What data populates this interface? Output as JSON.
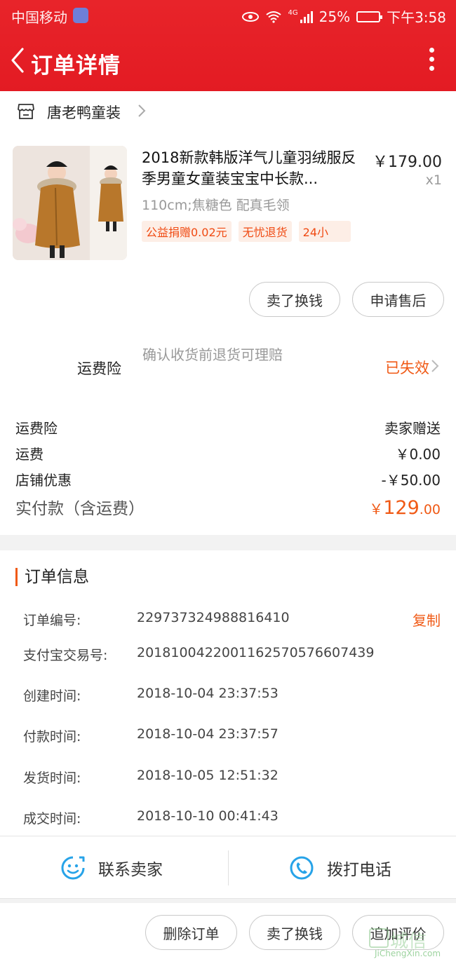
{
  "status_bar": {
    "carrier": "中国移动",
    "network": "4G",
    "battery": "25%",
    "time": "下午3:58"
  },
  "nav": {
    "title": "订单详情"
  },
  "shop": {
    "name": "唐老鸭童装"
  },
  "product": {
    "title": "2018新款韩版洋气儿童羽绒服反季男童女童装宝宝中长款...",
    "price": "￥179.00",
    "quantity": "x1",
    "spec": "110cm;焦糖色  配真毛领",
    "tags": [
      "公益捐赠0.02元",
      "无忧退货",
      "24小"
    ]
  },
  "product_actions": {
    "sell_exchange": "卖了换钱",
    "after_sale": "申请售后"
  },
  "freight_insurance": {
    "label": "运费险",
    "description": "确认收货前退货可理赔",
    "status": "已失效"
  },
  "summary": {
    "rows": [
      {
        "label": "运费险",
        "value": "卖家赠送"
      },
      {
        "label": "运费",
        "value": "￥0.00"
      },
      {
        "label": "店铺优惠",
        "value": "-￥50.00"
      }
    ],
    "total_label": "实付款（含运费）",
    "total_currency": "￥",
    "total_int": "129",
    "total_dec": ".00"
  },
  "order_info": {
    "title": "订单信息",
    "copy_label": "复制",
    "rows": [
      {
        "label": "订单编号:",
        "value": "229737324988816410"
      },
      {
        "label": "支付宝交易号:",
        "value": "2018100422001162570576607439"
      },
      {
        "label": "创建时间:",
        "value": "2018-10-04 23:37:53"
      },
      {
        "label": "付款时间:",
        "value": "2018-10-04 23:37:57"
      },
      {
        "label": "发货时间:",
        "value": "2018-10-05 12:51:32"
      },
      {
        "label": "成交时间:",
        "value": "2018-10-10 00:41:43"
      }
    ]
  },
  "contact": {
    "seller": "联系卖家",
    "call": "拨打电话"
  },
  "bottom_actions": {
    "delete": "删除订单",
    "sell_exchange": "卖了换钱",
    "review": "追加评价"
  },
  "watermark": {
    "cn": "城信",
    "url": "JiChengXin.com"
  },
  "colors": {
    "header_red": "#e31b23",
    "accent_orange": "#f05a16",
    "tag_bg": "#fdeee6",
    "contact_blue": "#27a3e8"
  }
}
